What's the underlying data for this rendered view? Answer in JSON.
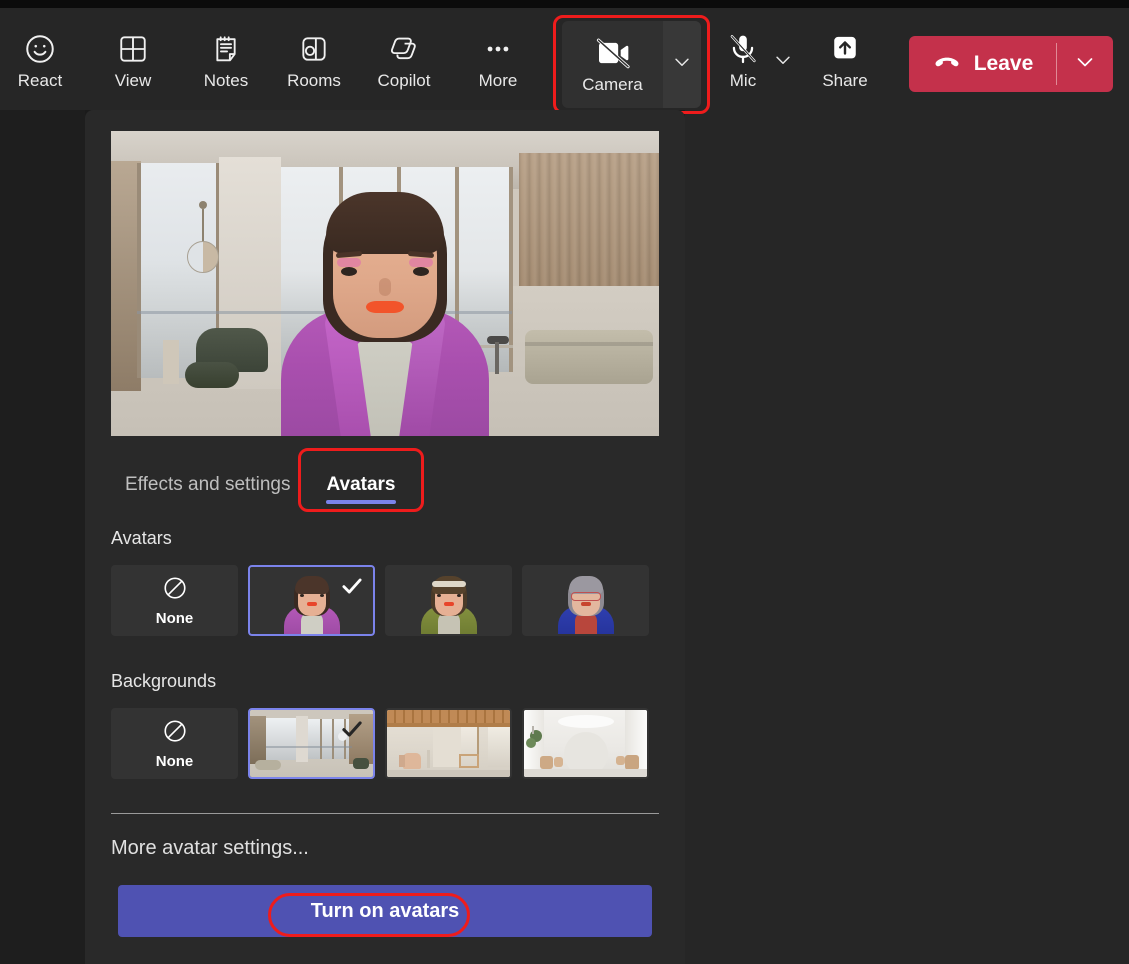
{
  "toolbar": {
    "items": [
      {
        "label": "React",
        "icon": "emoji-smiley-icon",
        "name": "react"
      },
      {
        "label": "View",
        "icon": "grid-view-icon",
        "name": "view"
      },
      {
        "label": "Notes",
        "icon": "notes-icon",
        "name": "notes"
      },
      {
        "label": "Rooms",
        "icon": "breakout-rooms-icon",
        "name": "rooms"
      },
      {
        "label": "Copilot",
        "icon": "copilot-icon",
        "name": "copilot"
      },
      {
        "label": "More",
        "icon": "more-ellipsis-icon",
        "name": "more"
      }
    ],
    "camera": {
      "label": "Camera",
      "icon": "camera-off-icon",
      "chevron_icon": "chevron-down-icon",
      "state": "off",
      "highlighted": true
    },
    "mic": {
      "label": "Mic",
      "icon": "mic-off-icon",
      "chevron_icon": "chevron-down-icon",
      "state": "muted"
    },
    "share": {
      "label": "Share",
      "icon": "share-screen-icon"
    },
    "leave": {
      "label": "Leave",
      "icon": "hang-up-icon",
      "chevron_icon": "chevron-down-icon",
      "color": "#c4314b"
    }
  },
  "panel": {
    "preview": {
      "name": "avatar-video-preview",
      "alt": "Avatar preview in modern lounge background"
    },
    "tabs": [
      {
        "label": "Effects and settings",
        "name": "effects-and-settings",
        "active": false,
        "highlighted": false
      },
      {
        "label": "Avatars",
        "name": "avatars",
        "active": true,
        "highlighted": true
      }
    ],
    "avatars_section": {
      "title": "Avatars",
      "items": [
        {
          "label": "None",
          "name": "avatar-none",
          "icon": "none-circle-slash-icon",
          "selected": false
        },
        {
          "label": "",
          "name": "avatar-1",
          "selected": true,
          "check_icon": "checkmark-icon"
        },
        {
          "label": "",
          "name": "avatar-2",
          "selected": false
        },
        {
          "label": "",
          "name": "avatar-3",
          "selected": false
        }
      ]
    },
    "backgrounds_section": {
      "title": "Backgrounds",
      "items": [
        {
          "label": "None",
          "name": "background-none",
          "icon": "none-circle-slash-icon",
          "selected": false
        },
        {
          "label": "",
          "name": "background-1",
          "selected": true,
          "check_icon": "checkmark-icon"
        },
        {
          "label": "",
          "name": "background-2",
          "selected": false
        },
        {
          "label": "",
          "name": "background-3",
          "selected": false
        }
      ]
    },
    "more_settings_label": "More avatar settings...",
    "turn_on_button": {
      "label": "Turn on avatars",
      "color": "#4f52b2",
      "highlighted": true
    }
  },
  "colors": {
    "accent_purple": "#4f52b2",
    "selected_border": "#7b83eb",
    "leave_red": "#c4314b",
    "highlight_red": "#ee1c1c",
    "panel_bg": "#292929",
    "toolbar_bg": "#262626"
  }
}
